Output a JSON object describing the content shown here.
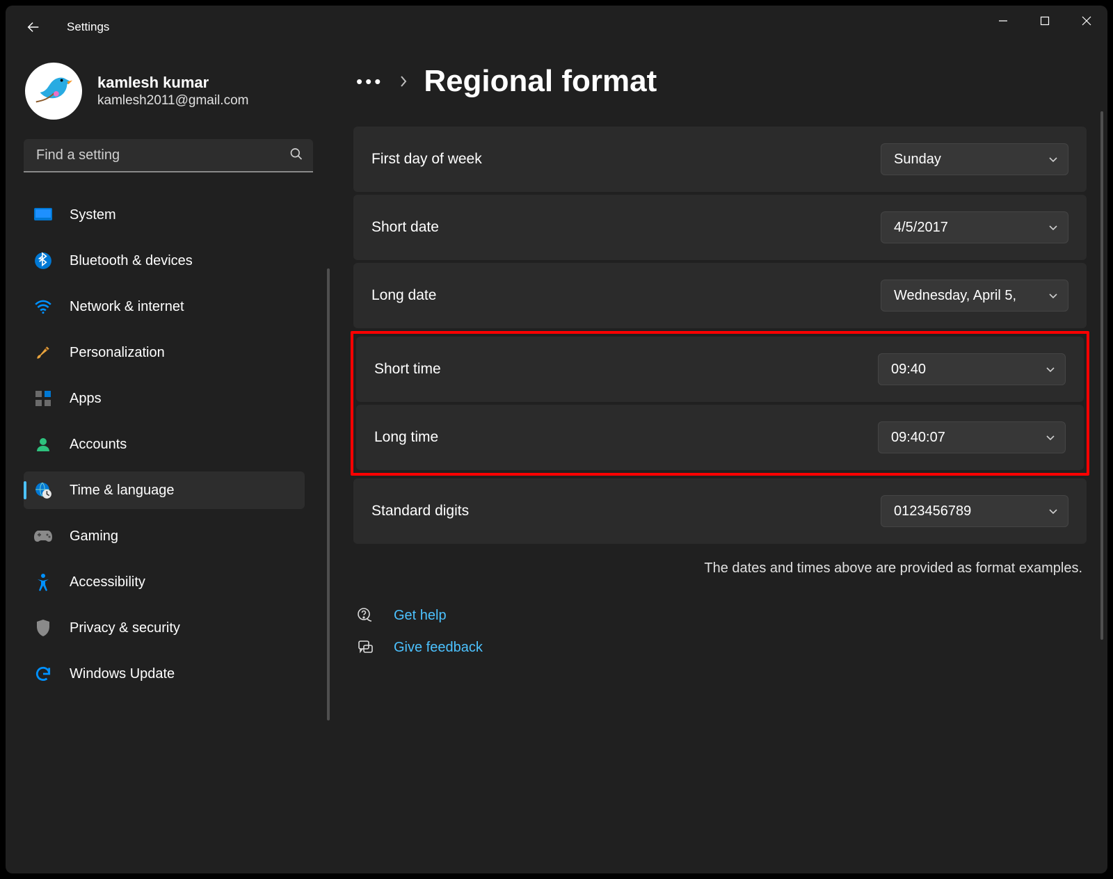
{
  "app": {
    "title": "Settings"
  },
  "user": {
    "name": "kamlesh kumar",
    "email": "kamlesh2011@gmail.com"
  },
  "search": {
    "placeholder": "Find a setting"
  },
  "nav": {
    "system": "System",
    "bluetooth": "Bluetooth & devices",
    "network": "Network & internet",
    "personalization": "Personalization",
    "apps": "Apps",
    "accounts": "Accounts",
    "time": "Time & language",
    "gaming": "Gaming",
    "accessibility": "Accessibility",
    "privacy": "Privacy & security",
    "update": "Windows Update"
  },
  "page": {
    "title": "Regional format"
  },
  "rows": {
    "first_day": {
      "label": "First day of week",
      "value": "Sunday"
    },
    "short_date": {
      "label": "Short date",
      "value": "4/5/2017"
    },
    "long_date": {
      "label": "Long date",
      "value": "Wednesday, April 5, "
    },
    "short_time": {
      "label": "Short time",
      "value": "09:40"
    },
    "long_time": {
      "label": "Long time",
      "value": "09:40:07"
    },
    "digits": {
      "label": "Standard digits",
      "value": "0123456789"
    }
  },
  "help_note": "The dates and times above are provided as format examples.",
  "links": {
    "get_help": "Get help",
    "feedback": "Give feedback"
  }
}
